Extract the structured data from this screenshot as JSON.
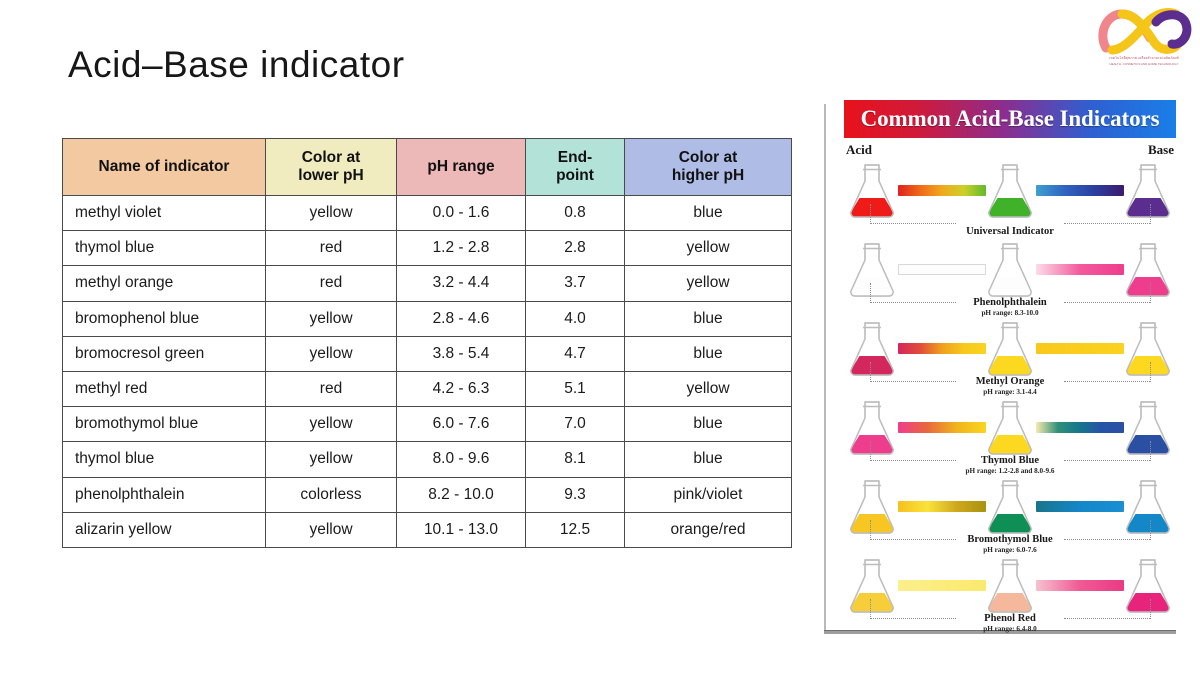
{
  "slide": {
    "title": "Acid–Base indicator"
  },
  "logo": {
    "name": "alpha-ribbon-logo",
    "caption_thai": "เทคโนโลยีสุขภาพ เครื่องสำอางและผลิตภัณฑ์",
    "caption_english": "HEALTH, COSMETICS AND HOME TECHNOLOGY",
    "colors": {
      "pink": "#f0868c",
      "yellow": "#f5c518",
      "purple": "#5b2d8e"
    }
  },
  "table": {
    "headers": [
      {
        "label": "Name of indicator",
        "bg": "#f2c9a0"
      },
      {
        "label": "Color at\nlower pH",
        "line1": "Color at",
        "line2": "lower pH",
        "bg": "#f0ecc0"
      },
      {
        "label": "pH range",
        "line1": "pH range",
        "line2": "",
        "bg": "#edb8b8"
      },
      {
        "label": "End-\npoint",
        "line1": "End-",
        "line2": "point",
        "bg": "#b3e3d8"
      },
      {
        "label": "Color at\nhigher pH",
        "line1": "Color at",
        "line2": "higher pH",
        "bg": "#aebce6"
      }
    ],
    "rows": [
      {
        "name": "methyl violet",
        "low": "yellow",
        "range": "0.0 - 1.6",
        "endpoint": "0.8",
        "high": "blue"
      },
      {
        "name": "thymol blue",
        "low": "red",
        "range": "1.2 - 2.8",
        "endpoint": "2.8",
        "high": "yellow"
      },
      {
        "name": "methyl orange",
        "low": "red",
        "range": "3.2 - 4.4",
        "endpoint": "3.7",
        "high": "yellow"
      },
      {
        "name": "bromophenol blue",
        "low": "yellow",
        "range": "2.8 - 4.6",
        "endpoint": "4.0",
        "high": "blue"
      },
      {
        "name": "bromocresol green",
        "low": "yellow",
        "range": "3.8 - 5.4",
        "endpoint": "4.7",
        "high": "blue"
      },
      {
        "name": "methyl red",
        "low": "red",
        "range": "4.2 - 6.3",
        "endpoint": "5.1",
        "high": "yellow"
      },
      {
        "name": "bromothymol blue",
        "low": "yellow",
        "range": "6.0 - 7.6",
        "endpoint": "7.0",
        "high": "blue"
      },
      {
        "name": "thymol blue",
        "low": "yellow",
        "range": "8.0 - 9.6",
        "endpoint": "8.1",
        "high": "blue"
      },
      {
        "name": "phenolphthalein",
        "low": "colorless",
        "range": "8.2 - 10.0",
        "endpoint": "9.3",
        "high": "pink/violet"
      },
      {
        "name": "alizarin yellow",
        "low": "yellow",
        "range": "10.1 - 13.0",
        "endpoint": "12.5",
        "high": "orange/red"
      }
    ]
  },
  "poster": {
    "title": "Common Acid-Base Indicators",
    "acid_label": "Acid",
    "base_label": "Base",
    "banner_gradient": [
      "#e8121b",
      "#1a7ee8"
    ],
    "rows": [
      {
        "name": "Universal Indicator",
        "ph_range": "",
        "acid_color": "#ef1b18",
        "mid_color": "#3fb22a",
        "base_color": "#5b2d8e",
        "bar1": "linear-gradient(to right, #e02020, #ef6a18, #f0a81e, #ccd029, #5fbb2c)",
        "bar2": "linear-gradient(to right, #3f9fd0, #2f63c0, #2a3f9e, #3b1b6e)"
      },
      {
        "name": "Phenolphthalein",
        "ph_range": "pH range: 8.3-10.0",
        "acid_color": "#fdfdfd",
        "mid_color": "#fdfdfd",
        "base_color": "#ef3d8e",
        "bar1": "linear-gradient(to right, #fdfdfd, #fdfdfd)",
        "bar2": "linear-gradient(to right, #fbdce8, #f25a9c, #ef3d8e)"
      },
      {
        "name": "Methyl Orange",
        "ph_range": "pH range: 3.1-4.4",
        "acid_color": "#d4275e",
        "mid_color": "#fcd821",
        "base_color": "#fcd821",
        "bar1": "linear-gradient(to right, #d4275e, #e04c3a, #efa01e, #f7c81c, #fbd41f)",
        "bar2": "linear-gradient(to right, #f9c81b, #fbd21f)"
      },
      {
        "name": "Thymol Blue",
        "ph_range": "pH range: 1.2-2.8 and 8.0-9.6",
        "acid_color": "#ef3d8e",
        "mid_color": "#fcd821",
        "base_color": "#2b4fa2",
        "bar1": "linear-gradient(to right, #ef3d8e, #e8683c, #f0b41e, #fbd41f)",
        "bar2": "linear-gradient(to right, #f7eab0, #2f9078, #16758a, #2552a8, #2b4fa2)"
      },
      {
        "name": "Bromothymol Blue",
        "ph_range": "pH range: 6.0-7.6",
        "acid_color": "#f8c622",
        "mid_color": "#0e8f55",
        "base_color": "#1487c8",
        "bar1": "linear-gradient(to right, #f6c01e, #fbe23c, #cfa81c, #a8920e)",
        "bar2": "linear-gradient(to right, #19748a, #1487c8, #1a8fd2)"
      },
      {
        "name": "Phenol Red",
        "ph_range": "pH range: 6.4-8.0",
        "acid_color": "#f6ce3a",
        "mid_color": "#f5b89c",
        "base_color": "#e8237c",
        "bar1": "linear-gradient(to right, #fbef8a, #fbe96e)",
        "bar2": "linear-gradient(to right, #f6c2cf, #ef5a95, #ea3a84)"
      }
    ]
  }
}
